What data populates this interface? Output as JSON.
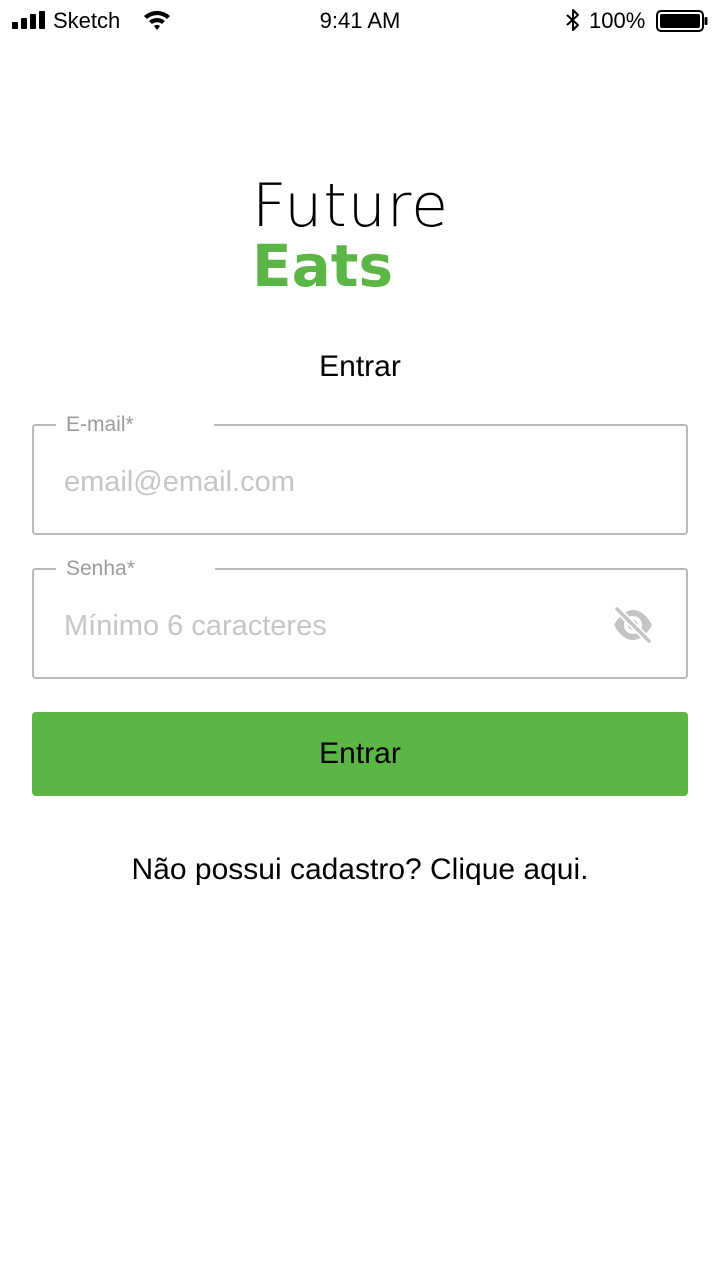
{
  "status_bar": {
    "carrier": "Sketch",
    "time": "9:41 AM",
    "battery_percent": "100%",
    "icons": [
      "signal-icon",
      "wifi-icon",
      "bluetooth-icon",
      "battery-icon"
    ]
  },
  "logo": {
    "line1": "Future",
    "line2": "Eats",
    "accent_color": "#5cb646"
  },
  "heading": "Entrar",
  "form": {
    "email": {
      "label": "E-mail",
      "required_mark": "*",
      "value": "",
      "placeholder": "email@email.com"
    },
    "password": {
      "label": "Senha",
      "required_mark": "*",
      "value": "",
      "placeholder": "Mínimo 6 caracteres",
      "toggle_icon": "eye-off-icon"
    },
    "submit_label": "Entrar",
    "button_color": "#5cb646"
  },
  "signup_prompt": "Não possui cadastro? Clique aqui."
}
